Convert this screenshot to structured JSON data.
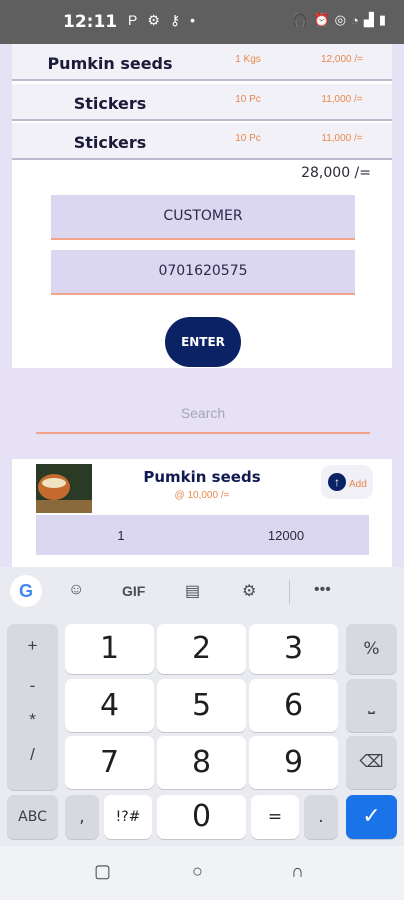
{
  "status_bar": {
    "time": "12:11",
    "left_icons": [
      "parking-icon",
      "gear-icon",
      "key-icon",
      "dot-icon"
    ],
    "right_icons": [
      "headset-icon",
      "alarm-icon",
      "hotspot-icon",
      "wifi-icon",
      "signal-icon",
      "battery-icon"
    ]
  },
  "order": {
    "items": [
      {
        "name": "Pumkin seeds",
        "qty": "1 Kgs",
        "price": "12,000 /="
      },
      {
        "name": "Stickers",
        "qty": "10 Pc",
        "price": "11,000 /="
      },
      {
        "name": "Stickers",
        "qty": "10 Pc",
        "price": "11,000 /="
      }
    ],
    "total": "28,000 /="
  },
  "form": {
    "customer_value": "CUSTOMER",
    "phone_value": "0701620575",
    "enter_label": "ENTER"
  },
  "search": {
    "placeholder": "Search"
  },
  "product": {
    "name": "Pumkin seeds",
    "price": "@ 10,000 /=",
    "add_label": "Add",
    "quantity": "1",
    "total": "12000"
  },
  "keyboard": {
    "toolbar": {
      "gif_label": "GIF",
      "icons": [
        "google-icon",
        "sticker-icon",
        "clipboard-icon",
        "gear-icon",
        "more-icon"
      ]
    },
    "symbols": [
      "+",
      "-",
      "*",
      "/"
    ],
    "digits": [
      "1",
      "2",
      "3",
      "4",
      "5",
      "6",
      "7",
      "8",
      "9",
      "0"
    ],
    "percent": "%",
    "space": "⎵",
    "backspace": "⌫",
    "abc": "ABC",
    "comma": ",",
    "sym": "!?#",
    "equals": "=",
    "dot": ".",
    "done": "✓"
  },
  "nav": {
    "icons": [
      "recents-icon",
      "home-icon",
      "back-icon"
    ]
  }
}
